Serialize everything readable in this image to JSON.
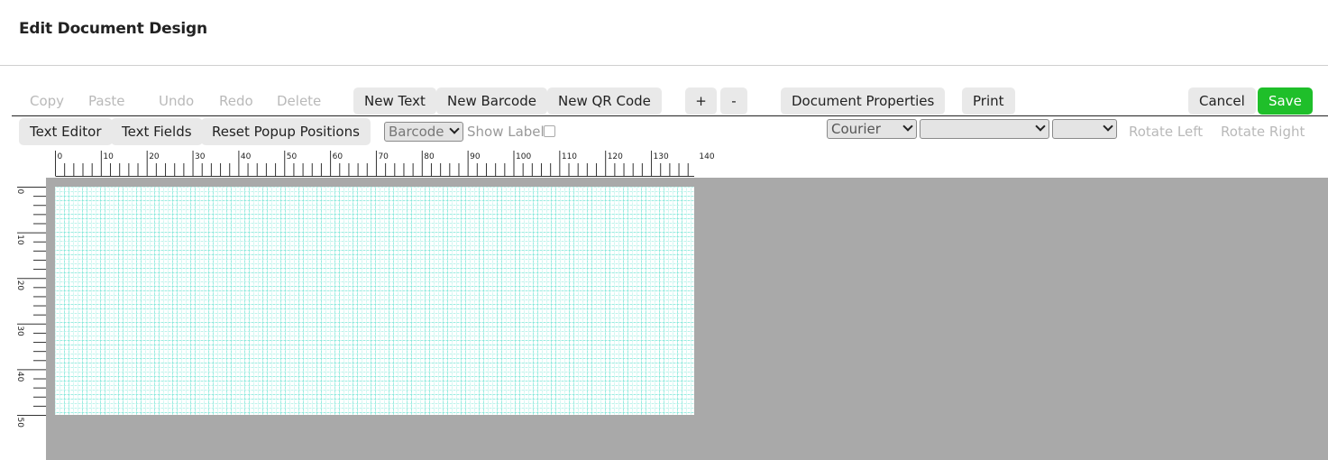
{
  "header": {
    "title": "Edit Document Design"
  },
  "toolbar": {
    "copy": "Copy",
    "paste": "Paste",
    "undo": "Undo",
    "redo": "Redo",
    "delete": "Delete",
    "new_text": "New Text",
    "new_barcode": "New Barcode",
    "new_qr": "New QR Code",
    "zoom_in": "+",
    "zoom_out": "-",
    "doc_props": "Document Properties",
    "print": "Print",
    "cancel": "Cancel",
    "save": "Save",
    "text_editor": "Text Editor",
    "text_fields": "Text Fields",
    "reset_popups": "Reset Popup Positions",
    "barcode_select": "Barcode",
    "show_label": "Show Label",
    "font_select": "Courier",
    "rotate_left": "Rotate Left",
    "rotate_right": "Rotate Right"
  },
  "ruler": {
    "h_labels": [
      "0",
      "10",
      "20",
      "30",
      "40",
      "50",
      "60",
      "70",
      "80",
      "90",
      "100",
      "110",
      "120",
      "130",
      "140"
    ],
    "v_labels": [
      "0",
      "10",
      "20",
      "30",
      "40",
      "50"
    ]
  },
  "colors": {
    "save": "#1fbf2a",
    "grid": "#78e6d7",
    "workspace": "#a9a9a9"
  }
}
